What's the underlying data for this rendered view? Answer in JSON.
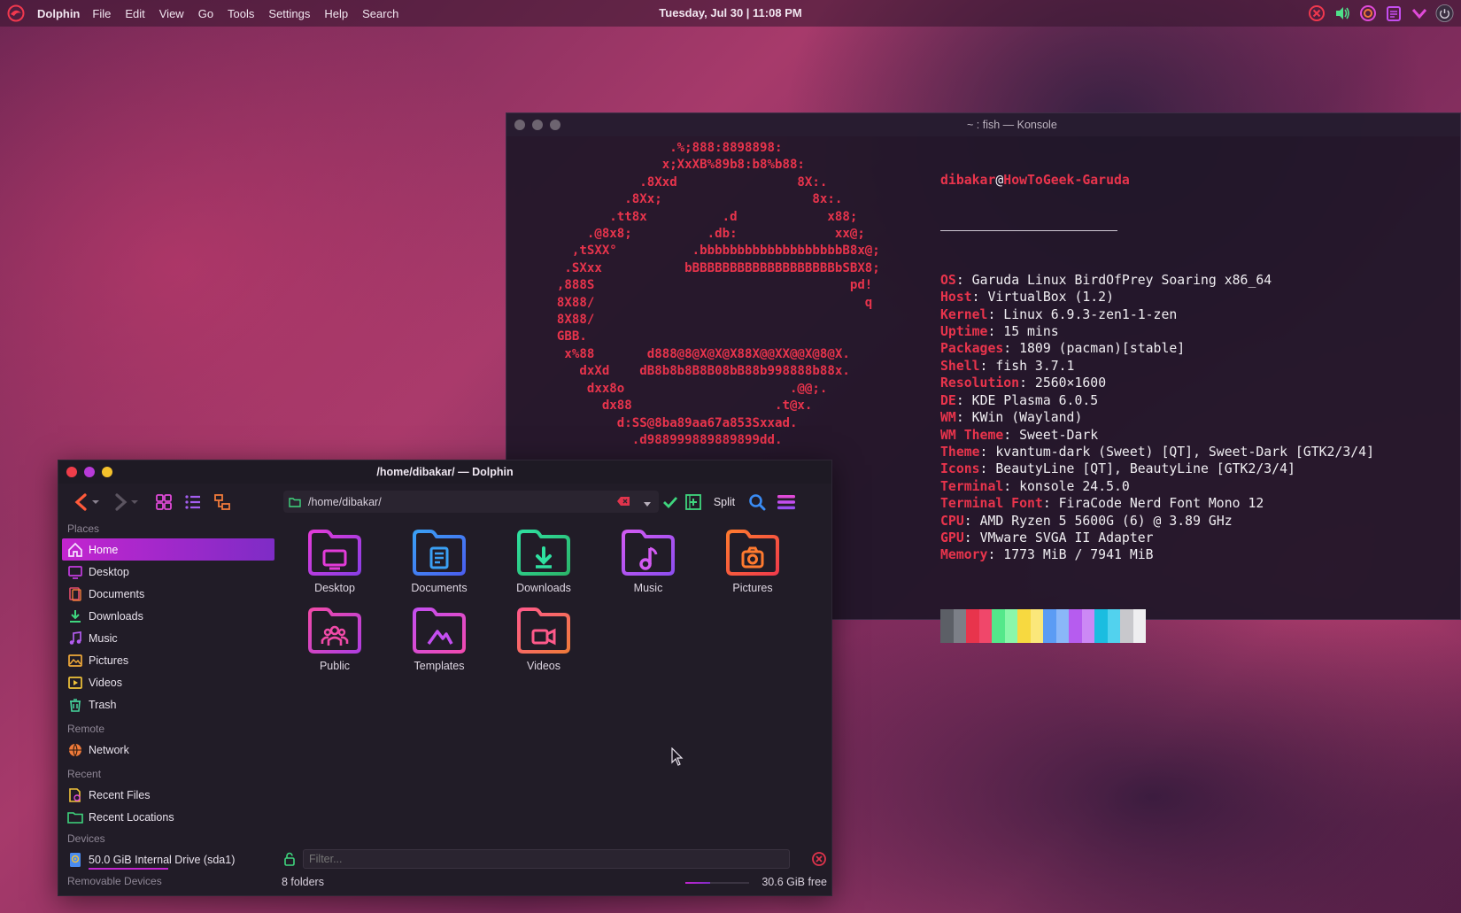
{
  "top_panel": {
    "app_name": "Dolphin",
    "menu": [
      "File",
      "Edit",
      "View",
      "Go",
      "Tools",
      "Settings",
      "Help",
      "Search"
    ],
    "clock": "Tuesday, Jul 30 | 11:08 PM",
    "tray_icons": [
      "close-circle-icon",
      "volume-icon",
      "swirl-icon",
      "clipboard-icon",
      "chevron-down-icon",
      "power-icon"
    ]
  },
  "konsole": {
    "title": "~ : fish — Konsole",
    "ascii_art": "                     .%;888:8898898:\n                    x;XxXB%89b8:b8%b88:\n                 .8Xxd                8X:.\n               .8Xx;                    8x:.\n             .tt8x          .d            x88;\n          .@8x8;          .db:             xx@;\n        ,tSXX°          .bbbbbbbbbbbbbbbbbbbB8x@;\n       .SXxx           bBBBBBBBBBBBBBBBBBBBbSBX8;\n      ,888S                                  pd!\n      8X88/                                    q\n      8X88/\n      GBB.\n       x%88       d888@8@X@X@X88X@@XX@@X@8@X.\n         dxXd    dB8b8b8B8B08bB88b998888b88x.\n          dxx8o                      .@@;.\n            dx88                   .t@x.\n              d:SS@8ba89aa67a853Sxxad.\n                .d988999889889899dd.",
    "user": "dibakar",
    "at": "@",
    "host": "HowToGeek-Garuda",
    "info": [
      {
        "key": "OS",
        "value": "Garuda Linux BirdOfPrey Soaring x86_64"
      },
      {
        "key": "Host",
        "value": "VirtualBox (1.2)"
      },
      {
        "key": "Kernel",
        "value": "Linux 6.9.3-zen1-1-zen"
      },
      {
        "key": "Uptime",
        "value": "15 mins"
      },
      {
        "key": "Packages",
        "value": "1809 (pacman)[stable]"
      },
      {
        "key": "Shell",
        "value": "fish 3.7.1"
      },
      {
        "key": "Resolution",
        "value": "2560×1600"
      },
      {
        "key": "DE",
        "value": "KDE Plasma 6.0.5"
      },
      {
        "key": "WM",
        "value": "KWin (Wayland)"
      },
      {
        "key": "WM Theme",
        "value": "Sweet-Dark"
      },
      {
        "key": "Theme",
        "value": "kvantum-dark (Sweet) [QT], Sweet-Dark [GTK2/3/4]"
      },
      {
        "key": "Icons",
        "value": "BeautyLine [QT], BeautyLine [GTK2/3/4]"
      },
      {
        "key": "Terminal",
        "value": "konsole 24.5.0"
      },
      {
        "key": "Terminal Font",
        "value": "FiraCode Nerd Font Mono 12"
      },
      {
        "key": "CPU",
        "value": "AMD Ryzen 5 5600G (6) @ 3.89 GHz"
      },
      {
        "key": "GPU",
        "value": "VMware SVGA II Adapter"
      },
      {
        "key": "Memory",
        "value": "1773 MiB / 7941 MiB"
      }
    ],
    "palette": [
      "#5c5f66",
      "#7c7f87",
      "#e8344c",
      "#f0476a",
      "#54e88a",
      "#8af7aa",
      "#f7d940",
      "#fbe77a",
      "#5b9cf4",
      "#8ab8f8",
      "#b65cef",
      "#cc88f5",
      "#1bbde0",
      "#52d2ee",
      "#c8c8cc",
      "#eeeef0"
    ]
  },
  "dolphin": {
    "title": "/home/dibakar/ — Dolphin",
    "path": "/home/dibakar/",
    "split_label": "Split",
    "places_header": "Places",
    "places": [
      {
        "label": "Home",
        "icon": "home-icon",
        "color": "#f6e0ff",
        "active": true
      },
      {
        "label": "Desktop",
        "icon": "desktop-icon",
        "color": "#c33be0"
      },
      {
        "label": "Documents",
        "icon": "documents-icon",
        "color": "#e24b6b"
      },
      {
        "label": "Downloads",
        "icon": "download-icon",
        "color": "#3fd67e"
      },
      {
        "label": "Music",
        "icon": "music-icon",
        "color": "#b35cf0"
      },
      {
        "label": "Pictures",
        "icon": "pictures-icon",
        "color": "#f0a93a"
      },
      {
        "label": "Videos",
        "icon": "videos-icon",
        "color": "#f0c23a"
      },
      {
        "label": "Trash",
        "icon": "trash-icon",
        "color": "#46d39c"
      }
    ],
    "remote_header": "Remote",
    "remote": [
      {
        "label": "Network",
        "icon": "network-icon",
        "color": "#f07a3a"
      }
    ],
    "recent_header": "Recent",
    "recent": [
      {
        "label": "Recent Files",
        "icon": "recent-files-icon",
        "color": "#f0c23a"
      },
      {
        "label": "Recent Locations",
        "icon": "recent-locations-icon",
        "color": "#3fd67e"
      }
    ],
    "devices_header": "Devices",
    "devices": [
      {
        "label": "50.0 GiB Internal Drive (sda1)",
        "icon": "drive-icon",
        "color": "#4a8cf0"
      }
    ],
    "removable_header": "Removable Devices",
    "folders": [
      {
        "name": "Desktop",
        "icon": "desktop-folder-icon",
        "c1": "#e33bd8",
        "c2": "#8a3ee6"
      },
      {
        "name": "Documents",
        "icon": "documents-folder-icon",
        "c1": "#3aa0f5",
        "c2": "#4a5ff0"
      },
      {
        "name": "Downloads",
        "icon": "downloads-folder-icon",
        "c1": "#2fe0a0",
        "c2": "#2bb56a"
      },
      {
        "name": "Music",
        "icon": "music-folder-icon",
        "c1": "#d25af2",
        "c2": "#8e4ef0"
      },
      {
        "name": "Pictures",
        "icon": "pictures-folder-icon",
        "c1": "#ff7a2f",
        "c2": "#f03b4a"
      },
      {
        "name": "Public",
        "icon": "public-folder-icon",
        "c1": "#f04aa8",
        "c2": "#b03ee0"
      },
      {
        "name": "Templates",
        "icon": "templates-folder-icon",
        "c1": "#c44ef0",
        "c2": "#f04ab0"
      },
      {
        "name": "Videos",
        "icon": "videos-folder-icon",
        "c1": "#ff5a8a",
        "c2": "#f07a3a"
      }
    ],
    "filter_placeholder": "Filter...",
    "status_count": "8 folders",
    "status_free": "30.6 GiB free",
    "disk_used_fraction": 0.39
  }
}
